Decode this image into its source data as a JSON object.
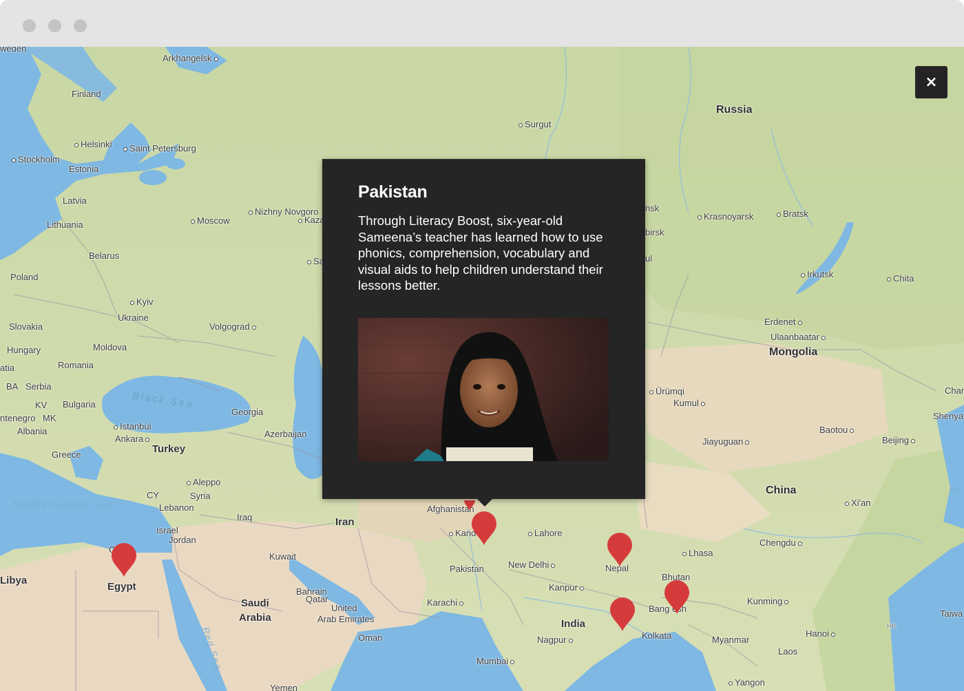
{
  "window": {
    "buttons": [
      "close",
      "minimize",
      "maximize"
    ]
  },
  "map": {
    "labels": {
      "sweden": "weden",
      "arkhangelsk": "Arkhangelsk",
      "finland": "Finland",
      "russia": "Russia",
      "surgut": "Surgut",
      "helsinki": "Helsinki",
      "saint_petersburg": "Saint Petersburg",
      "stockholm": "Stockholm",
      "estonia": "Estonia",
      "latvia": "Latvia",
      "lithuania": "Lithuania",
      "moscow": "Moscow",
      "nizhny": "Nizhny Novgoro",
      "kazan": "Kaza",
      "samara": "Sa",
      "belarus": "Belarus",
      "poland": "Poland",
      "kyiv": "Kyiv",
      "ukraine": "Ukraine",
      "volgograd": "Volgograd",
      "slovakia": "Slovakia",
      "moldova": "Moldova",
      "hungary": "Hungary",
      "romania": "Romania",
      "croatia": "atia",
      "ba": "BA",
      "serbia": "Serbia",
      "kv": "KV",
      "bulgaria": "Bulgaria",
      "montenegro": "ntenegro",
      "mk": "MK",
      "albania": "Albania",
      "black_sea": "Black Sea",
      "georgia": "Georgia",
      "istanbul": "Istanbul",
      "ankara": "Ankara",
      "turkey": "Turkey",
      "azerbaijan": "Azerbaijan",
      "greece": "Greece",
      "aleppo": "Aleppo",
      "cy": "CY",
      "syria": "Syria",
      "lebanon": "Lebanon",
      "iraq": "Iraq",
      "israel": "Israel",
      "jordan": "Jordan",
      "iran": "Iran",
      "mediterranean": "Mediterranean Sea",
      "cairo": "C",
      "egypt": "Egypt",
      "libya": "Libya",
      "kuwait": "Kuwait",
      "saudi_arabia_1": "Saudi",
      "saudi_arabia_2": "Arabia",
      "bahrain": "Bahrain",
      "qatar": "Qatar",
      "uae_1": "United",
      "uae_2": "Arab Emirates",
      "oman": "Oman",
      "yemen": "Yemen",
      "red_sea": "Red Sea",
      "afghanistan": "Afghanistan",
      "kandahar": "Kand",
      "lahore": "Lahore",
      "pakistan": "Pakistan",
      "new_delhi": "New Delhi",
      "karachi": "Karachi",
      "kanpur": "Kanpur",
      "india": "India",
      "nagpur": "Nagpur",
      "mumbai": "Mumbai",
      "nepal": "Nepal",
      "lhasa": "Lhasa",
      "bhutan": "Bhutan",
      "bangladesh": "Bang   esh",
      "kolkata": "Kolkata",
      "kunming": "Kunming",
      "myanmar": "Myanmar",
      "hanoi": "Hanoi",
      "laos": "Laos",
      "yangon": "Yangon",
      "taiwan": "Taiwa",
      "hk": "HK",
      "chengdu": "Chengdu",
      "china": "China",
      "xian": "Xi'an",
      "jiayuguan": "Jiayuguan",
      "baotou": "Baotou",
      "beijing": "Beijing",
      "shenyang": "Shenya",
      "harbin": "Char",
      "yellow_sea": "Ye",
      "urumqi": "Ürümqi",
      "kumul": "Kumul",
      "mongolia": "Mongolia",
      "ulaanbaatar": "Ulaanbaatar",
      "erdenet": "Erdenet",
      "irkutsk": "Irkutsk",
      "chita": "Chita",
      "krasnoyarsk": "Krasnoyarsk",
      "bratsk": "Bratsk",
      "novosibirsk": "nsk",
      "barnaul": "birsk",
      "ul": "ul"
    },
    "marker_color": "#d63b3b",
    "markers": [
      "egypt",
      "pakistan",
      "nepal",
      "india",
      "bangladesh"
    ]
  },
  "popup": {
    "title": "Pakistan",
    "body": "Through Literacy Boost, six-year-old Sameena’s teacher has learned how to use phonics, comprehension, vocabulary and visual aids to help children understand their lessons better."
  },
  "close_button": {
    "label": "×"
  }
}
